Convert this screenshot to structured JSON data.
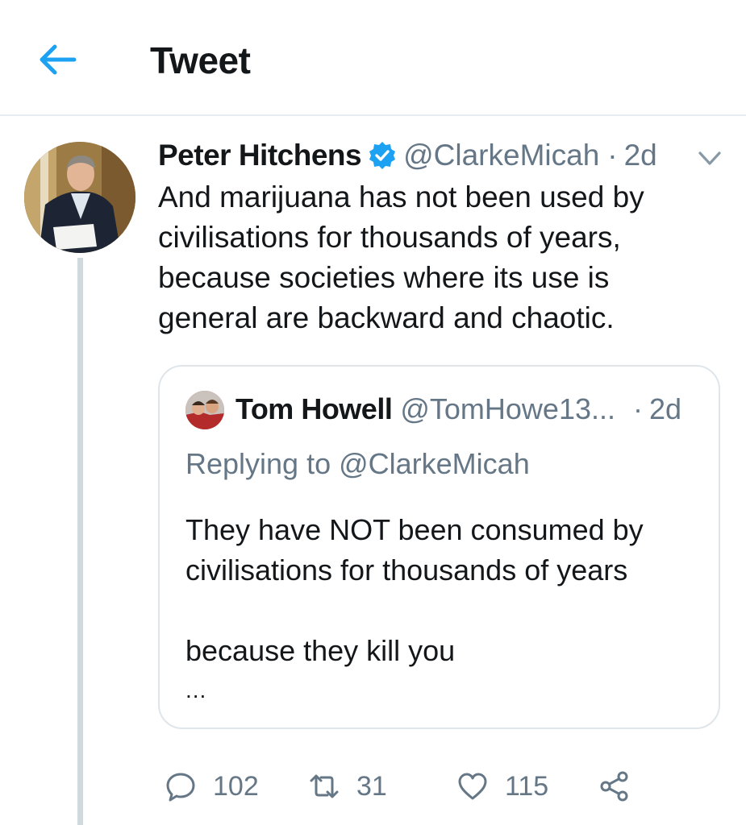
{
  "header": {
    "title": "Tweet",
    "back_icon": "arrow-left-icon",
    "accent_color": "#1da1f2"
  },
  "tweet": {
    "author_name": "Peter Hitchens",
    "verified": true,
    "handle": "@ClarkeMicah",
    "separator": "·",
    "time": "2d",
    "text": "And marijuana has not been used by\ncivilisations for thousands of years,\nbecause societies where its use is\ngeneral are backward and chaotic.",
    "menu_icon": "chevron-down-icon"
  },
  "quote": {
    "author_name": "Tom Howell",
    "handle": "@TomHowe13...",
    "separator": "·",
    "time": "2d",
    "replying_to": "Replying to @ClarkeMicah",
    "text": "They have NOT been consumed by\ncivilisations for thousands of years\n\nbecause they kill you",
    "more": "..."
  },
  "actions": {
    "replies": "102",
    "retweets": "31",
    "likes": "115",
    "icons": [
      "reply-icon",
      "retweet-icon",
      "like-icon",
      "share-icon"
    ]
  },
  "colors": {
    "text": "#14171a",
    "secondary": "#657786",
    "border": "#e6ecf0",
    "thread_line": "#cfd9de"
  }
}
